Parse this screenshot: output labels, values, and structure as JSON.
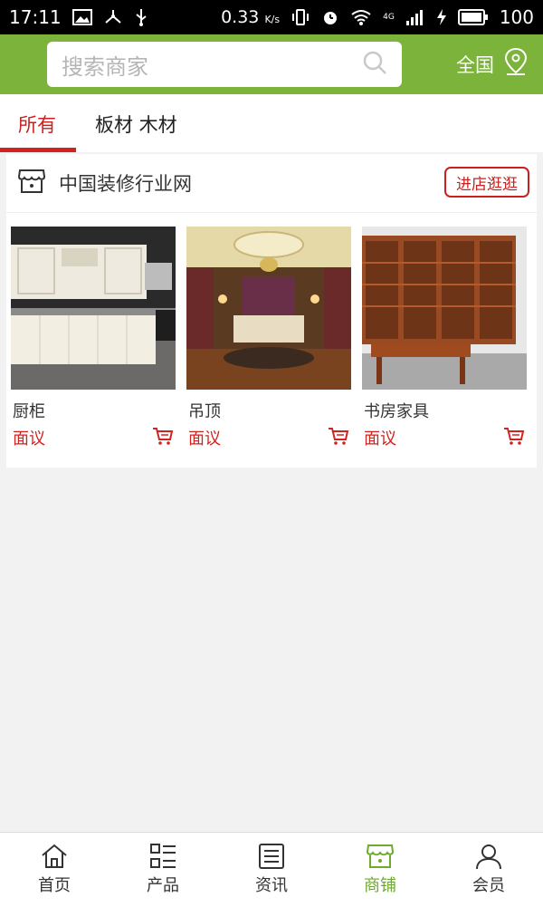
{
  "status_bar": {
    "time": "17:11",
    "speed": "0.33",
    "speed_unit": "K/s",
    "network": "4G",
    "battery": "100"
  },
  "header": {
    "search_placeholder": "搜索商家",
    "region_label": "全国"
  },
  "tabs": [
    {
      "label": "所有",
      "active": true
    },
    {
      "label": "板材 木材",
      "active": false
    }
  ],
  "store": {
    "name": "中国装修行业网",
    "visit_label": "进店逛逛"
  },
  "products": [
    {
      "name": "厨柜",
      "price": "面议"
    },
    {
      "name": "吊顶",
      "price": "面议"
    },
    {
      "name": "书房家具",
      "price": "面议"
    }
  ],
  "bottom_nav": [
    {
      "label": "首页",
      "icon": "home-icon",
      "active": false
    },
    {
      "label": "产品",
      "icon": "list-icon",
      "active": false
    },
    {
      "label": "资讯",
      "icon": "news-icon",
      "active": false
    },
    {
      "label": "商铺",
      "icon": "shop-icon",
      "active": true
    },
    {
      "label": "会员",
      "icon": "user-icon",
      "active": false
    }
  ],
  "colors": {
    "accent_green": "#7bb33b",
    "price_red": "#d2231f",
    "active_nav_green": "#6eaa2e"
  }
}
